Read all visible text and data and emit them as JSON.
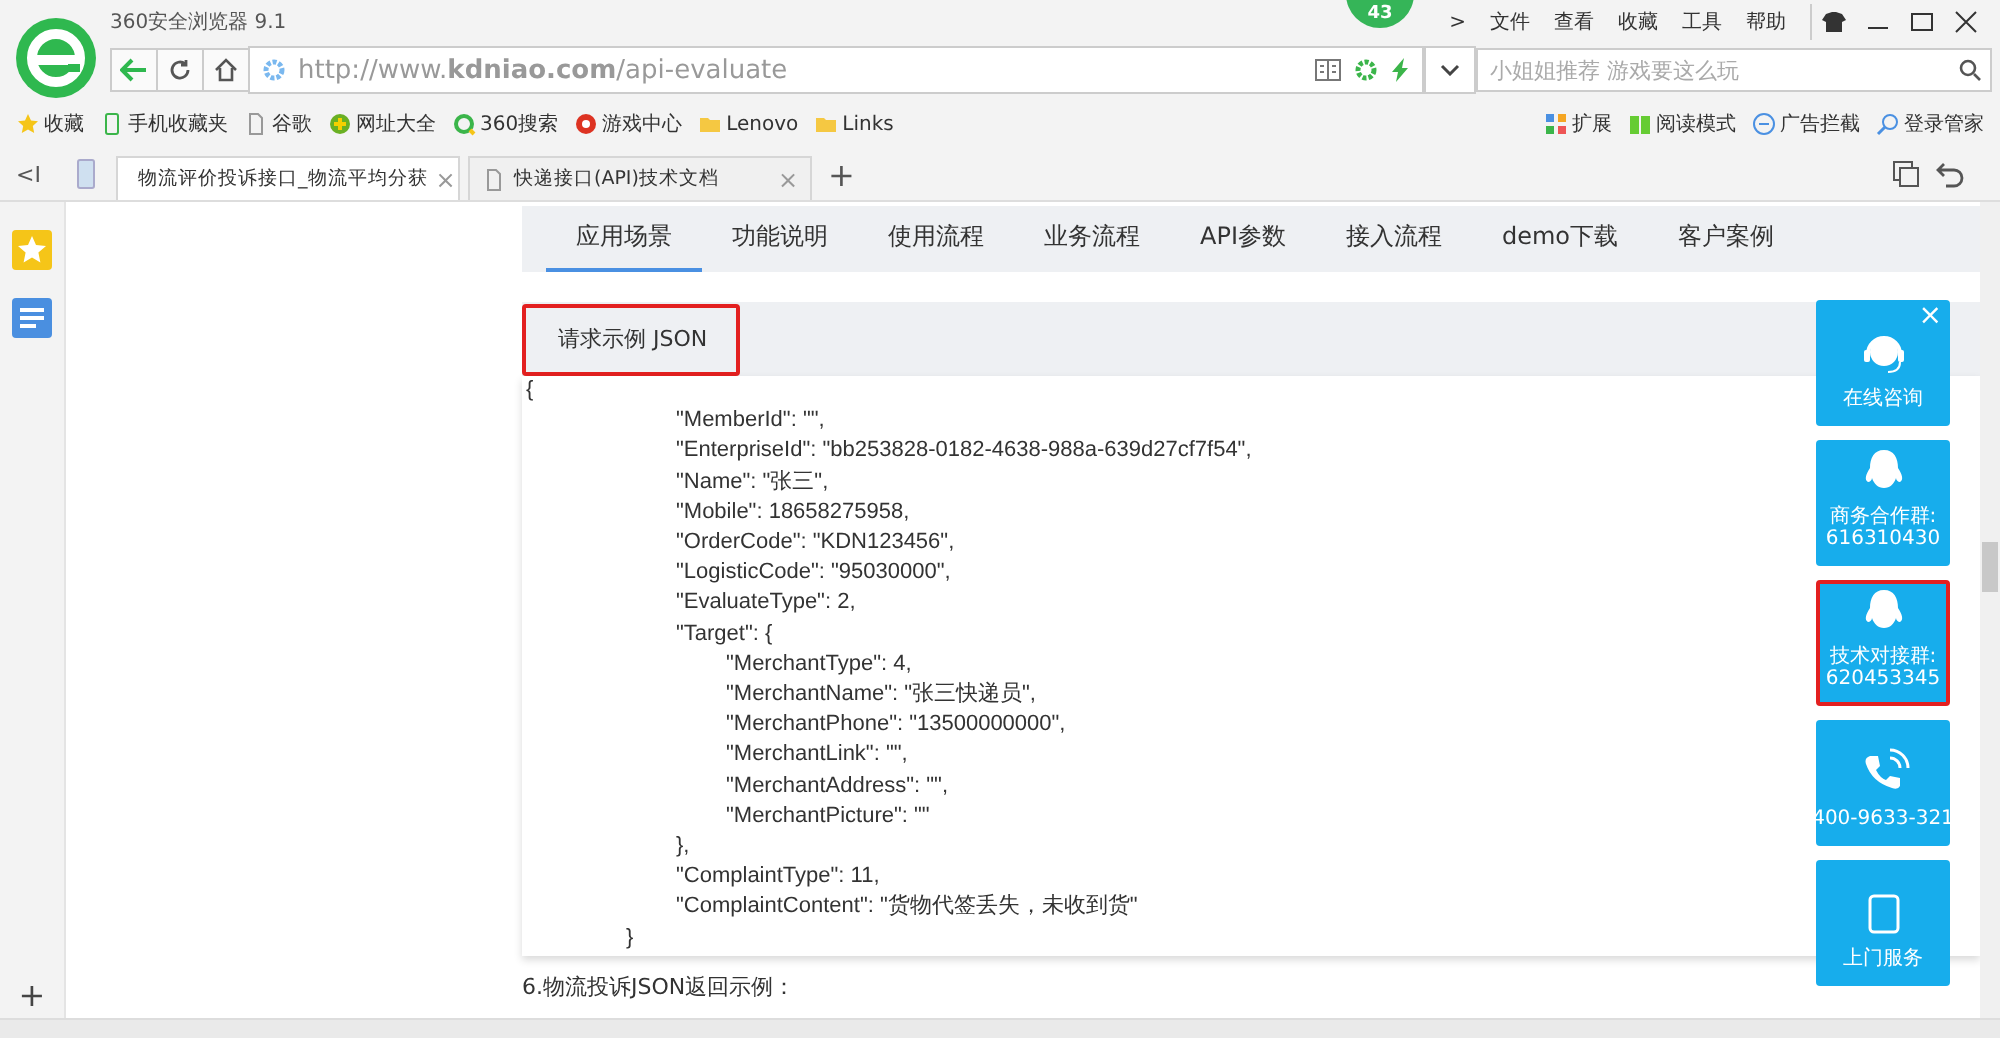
{
  "browser": {
    "title": "360安全浏览器 9.1",
    "badge": "43",
    "menu": [
      ">",
      "文件",
      "查看",
      "收藏",
      "工具",
      "帮助"
    ],
    "url": "http://www.**kdniao.com**/api-evaluate",
    "search": {
      "placeholder": "小姐姐推荐 游戏要这么玩"
    },
    "bookmarks": [
      {
        "label": "收藏",
        "kind": "star"
      },
      {
        "label": "手机收藏夹",
        "kind": "phone"
      },
      {
        "label": "谷歌",
        "kind": "page"
      },
      {
        "label": "网址大全",
        "kind": "globe"
      },
      {
        "label": "360搜索",
        "kind": "ring"
      },
      {
        "label": "游戏中心",
        "kind": "game"
      },
      {
        "label": "Lenovo",
        "kind": "folder"
      },
      {
        "label": "Links",
        "kind": "folder"
      }
    ],
    "tools": [
      {
        "label": "扩展",
        "kind": "apps"
      },
      {
        "label": "阅读模式",
        "kind": "book"
      },
      {
        "label": "广告拦截",
        "kind": "block"
      },
      {
        "label": "登录管家",
        "kind": "key"
      }
    ],
    "tab_back": "<I",
    "tabs": [
      {
        "label": "物流评价投诉接口_物流平均分获",
        "selected": true,
        "kind": "site"
      },
      {
        "label": "快递接口(API)技术文档",
        "selected": false,
        "kind": "page"
      }
    ],
    "new_tab": "+",
    "sidebar_add": "+",
    "tab_close": "×"
  },
  "page": {
    "nav": [
      {
        "label": "应用场景",
        "selected": true
      },
      {
        "label": "功能说明",
        "selected": false
      },
      {
        "label": "使用流程",
        "selected": false
      },
      {
        "label": "业务流程",
        "selected": false
      },
      {
        "label": "API参数",
        "selected": false
      },
      {
        "label": "接入流程",
        "selected": false
      },
      {
        "label": "demo下载",
        "selected": false
      },
      {
        "label": "客户案例",
        "selected": false
      }
    ],
    "section_title": {
      "text": "请求示例 JSON",
      "highlighted": true
    },
    "code": {
      "open": "{",
      "close": "}",
      "lines": [
        {
          "text": "\"MemberId\": \"\","
        },
        {
          "text": "\"EnterpriseId\": \"bb253828-0182-4638-988a-639d27cf7f54\","
        },
        {
          "text": "\"Name\": \"张三\","
        },
        {
          "text": "\"Mobile\": 18658275958,"
        },
        {
          "text": "\"OrderCode\": \"KDN123456\","
        },
        {
          "text": "\"LogisticCode\": \"95030000\","
        },
        {
          "text": "\"EvaluateType\": 2,"
        },
        {
          "text": "\"Target\": {",
          "children": [
            {
              "text": "\"MerchantType\": 4,"
            },
            {
              "text": "\"MerchantName\": \"张三快递员\","
            },
            {
              "text": "\"MerchantPhone\": \"13500000000\","
            },
            {
              "text": "\"MerchantLink\": \"\","
            },
            {
              "text": "\"MerchantAddress\": \"\","
            },
            {
              "text": "\"MerchantPicture\": \"\""
            }
          ]
        },
        {
          "text": "},"
        },
        {
          "text": "\"ComplaintType\": 11,"
        },
        {
          "text": "\"ComplaintContent\": \"货物代签丢失，未收到货\""
        }
      ]
    },
    "next_heading": "6.物流投诉JSON返回示例：",
    "panel_close": "×",
    "side_buttons": [
      {
        "label": "在线咨询",
        "kind": "headset",
        "highlighted": false
      },
      {
        "label": "商务合作群:\n616310430",
        "kind": "qq",
        "highlighted": false
      },
      {
        "label": "技术对接群:\n620453345",
        "kind": "qq",
        "highlighted": true
      },
      {
        "label": "400-9633-321",
        "kind": "phone",
        "highlighted": false
      },
      {
        "label": "上门服务",
        "kind": "home",
        "highlighted": false
      }
    ]
  }
}
